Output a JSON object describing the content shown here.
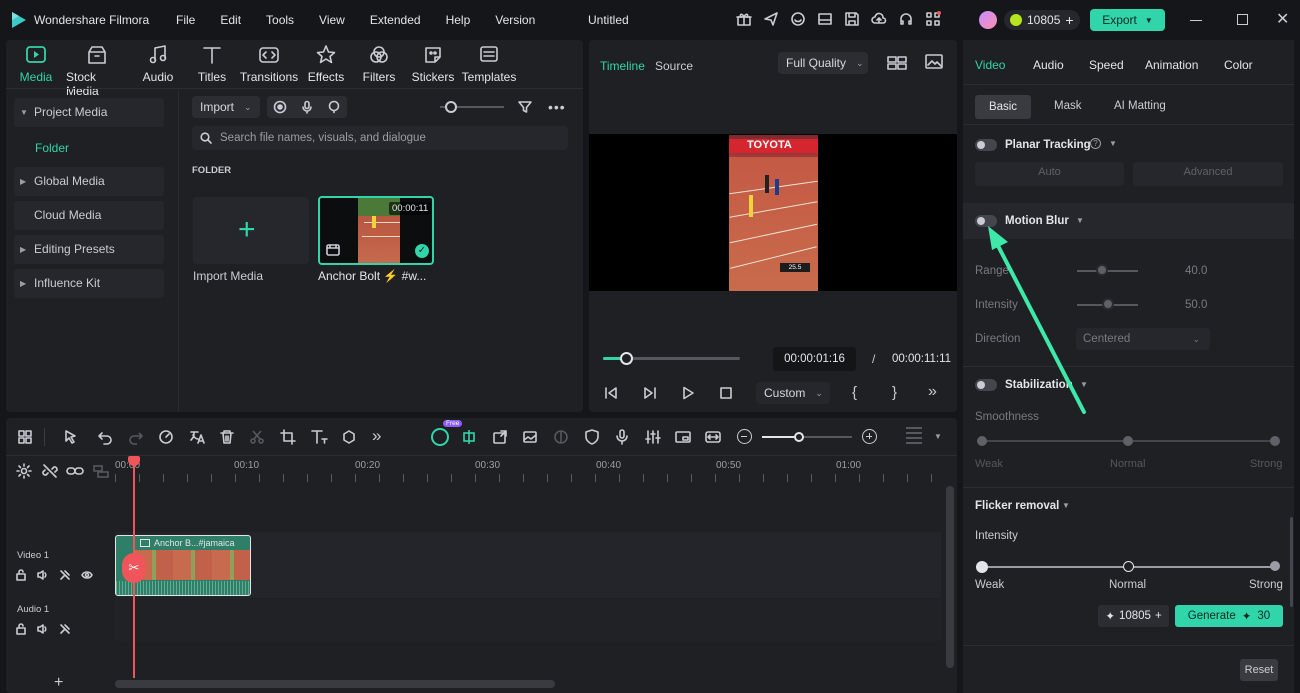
{
  "app": {
    "name": "Wondershare Filmora",
    "project_title": "Untitled",
    "credits": "10805",
    "export_label": "Export"
  },
  "menu": [
    "File",
    "Edit",
    "Tools",
    "View",
    "Extended",
    "Help",
    "Version"
  ],
  "toolbar_tabs": [
    {
      "label": "Media",
      "icon": "media-icon",
      "active": true
    },
    {
      "label": "Stock Media",
      "icon": "stock-media-icon"
    },
    {
      "label": "Audio",
      "icon": "music-note-icon"
    },
    {
      "label": "Titles",
      "icon": "text-t-icon"
    },
    {
      "label": "Transitions",
      "icon": "transitions-icon"
    },
    {
      "label": "Effects",
      "icon": "effects-icon"
    },
    {
      "label": "Filters",
      "icon": "filters-icon"
    },
    {
      "label": "Stickers",
      "icon": "stickers-icon"
    },
    {
      "label": "Templates",
      "icon": "templates-icon"
    }
  ],
  "sidebar": {
    "items": [
      {
        "label": "Project Media",
        "expanded": true
      },
      {
        "label": "Folder",
        "selected": true
      },
      {
        "label": "Global Media"
      },
      {
        "label": "Cloud Media"
      },
      {
        "label": "Editing Presets"
      },
      {
        "label": "Influence Kit"
      }
    ]
  },
  "media": {
    "import_label": "Import",
    "search_placeholder": "Search file names, visuals, and dialogue",
    "folder_heading": "FOLDER",
    "import_media_label": "Import Media",
    "clip": {
      "name": "Anchor Bolt ⚡ #w...",
      "duration": "00:00:11"
    }
  },
  "preview": {
    "tabs": [
      "Timeline",
      "Source"
    ],
    "quality": "Full Quality",
    "current_time": "00:00:01:16",
    "separator": "/",
    "total_time": "00:00:11:11",
    "zoom_label": "Custom",
    "progress_fraction": 0.17,
    "scoreboard": "25.5",
    "banner": "TOYOTA"
  },
  "properties": {
    "main_tabs": [
      "Video",
      "Audio",
      "Speed",
      "Animation",
      "Color"
    ],
    "sub_tabs": [
      "Basic",
      "Mask",
      "AI Matting"
    ],
    "planar_tracking": {
      "label": "Planar Tracking",
      "auto": "Auto",
      "advanced": "Advanced"
    },
    "motion_blur": {
      "label": "Motion Blur",
      "range_label": "Range",
      "range_value": "40.0",
      "intensity_label": "Intensity",
      "intensity_value": "50.0",
      "direction_label": "Direction",
      "direction_value": "Centered"
    },
    "stabilization": {
      "label": "Stabilization",
      "smoothness": "Smoothness",
      "weak": "Weak",
      "normal": "Normal",
      "strong": "Strong"
    },
    "flicker": {
      "label": "Flicker removal",
      "intensity": "Intensity",
      "weak": "Weak",
      "normal": "Normal",
      "strong": "Strong"
    },
    "generate": {
      "credits": "10805",
      "label": "Generate",
      "cost": "30"
    },
    "reset": "Reset"
  },
  "timeline": {
    "ruler": [
      "00:00",
      "00:10",
      "00:20",
      "00:30",
      "00:40",
      "00:50",
      "01:00"
    ],
    "badge": "Free",
    "video_track": "Video 1",
    "audio_track": "Audio 1",
    "clip_label": "Anchor B...#jamaica"
  },
  "colors": {
    "accent": "#30d5a9",
    "playhead": "#f0555b",
    "panel": "#1f2024"
  }
}
